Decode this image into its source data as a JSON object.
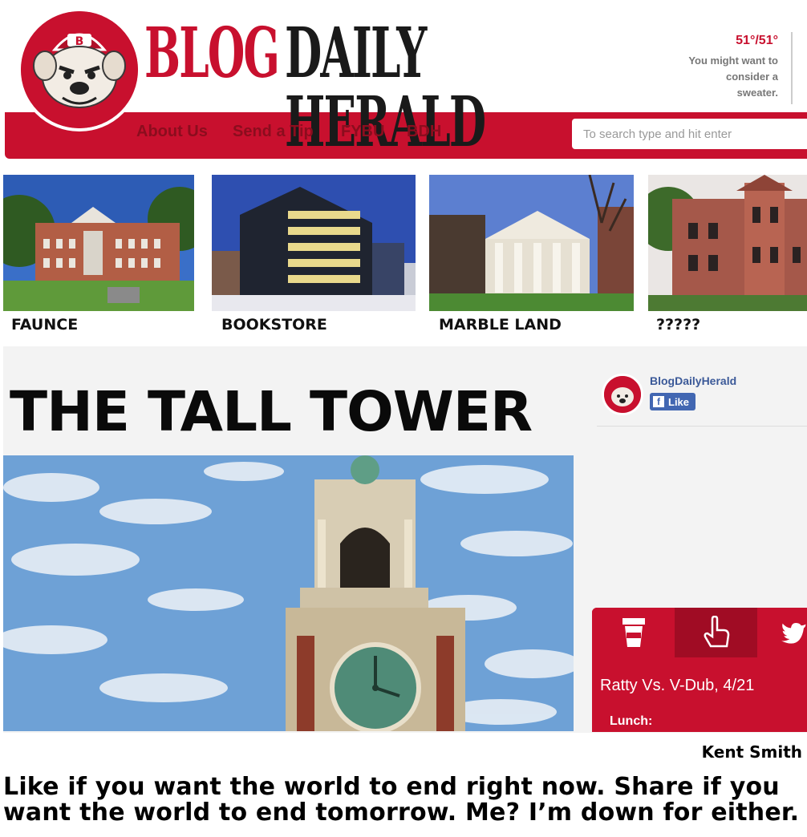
{
  "header": {
    "logo_text_part1": "BLOG",
    "logo_text_part2": "DAILY HERALD",
    "weather_temp": "51°/51°",
    "weather_note": "You might want to consider a sweater.",
    "nav": [
      "About Us",
      "Send a Tip",
      "FYBU",
      "BDH"
    ],
    "search_placeholder": "To search type and hit enter"
  },
  "thumbnails": [
    {
      "label": "FAUNCE"
    },
    {
      "label": "BOOKSTORE"
    },
    {
      "label": "MARBLE LAND"
    },
    {
      "label": "?????"
    }
  ],
  "article": {
    "title": "THE TALL TOWER",
    "author": "Kent Smith",
    "caption": "Like if you want the world to end right now. Share if you want the world to end tomorrow. Me? I’m down for either."
  },
  "facebook_widget": {
    "page_name": "BlogDailyHerald",
    "like_label": "Like"
  },
  "dining_widget": {
    "tabs": [
      "cup-icon",
      "pointer-hand-icon",
      "twitter-icon"
    ],
    "title": "Ratty Vs. V-Dub, 4/21",
    "section": "Lunch:"
  },
  "colors": {
    "brand_red": "#c8102e",
    "dark_red": "#8b0d1e",
    "facebook_blue": "#4267b2"
  }
}
